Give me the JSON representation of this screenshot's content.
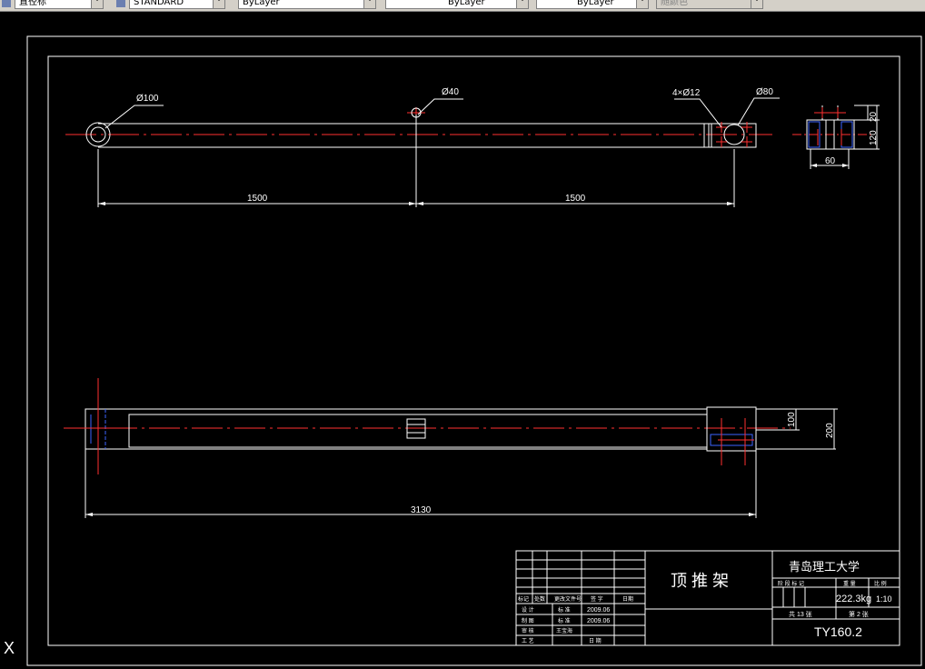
{
  "toolbar": {
    "items": [
      "直径标",
      "STANDARD",
      "ByLayer",
      "ByLayer",
      "ByLayer",
      "随颜色"
    ]
  },
  "drawing": {
    "top_view": {
      "dim_left": "1500",
      "dim_right": "1500",
      "dia_hole_left": "Ø100",
      "dia_hole_mid": "Ø40",
      "bolt_holes": "4×Ø12",
      "dia_hole_right": "Ø80"
    },
    "side_view": {
      "dim_width": "60",
      "dim_h1": "20",
      "dim_h2": "120"
    },
    "front_view": {
      "dim_length": "3130",
      "dim_inner": "100",
      "dim_outer": "200"
    },
    "title_block": {
      "part_name": "顶 推 架",
      "university": "青岛理工大学",
      "mass_header": "重 量",
      "scale_header": "比 例",
      "stage_header": "阶 段 标 记",
      "mass": "222.3kg",
      "scale": "1:10",
      "sheets_total": "共 13 张",
      "sheet_no": "第 2 张",
      "drawing_no": "TY160.2",
      "rev_headers": [
        "标记",
        "处数",
        "更改文件号",
        "签 字",
        "日期"
      ],
      "design_label": "设 计",
      "design_std": "标 准",
      "draw_label": "制 图",
      "draw_std": "标 准",
      "review_label": "审 核",
      "craft_label": "工 艺",
      "date1": "2009.06",
      "date2": "2009.06",
      "reviewer": "王宝海",
      "date_label": "日 期"
    }
  },
  "command": {
    "cursor_glyph": "X"
  }
}
